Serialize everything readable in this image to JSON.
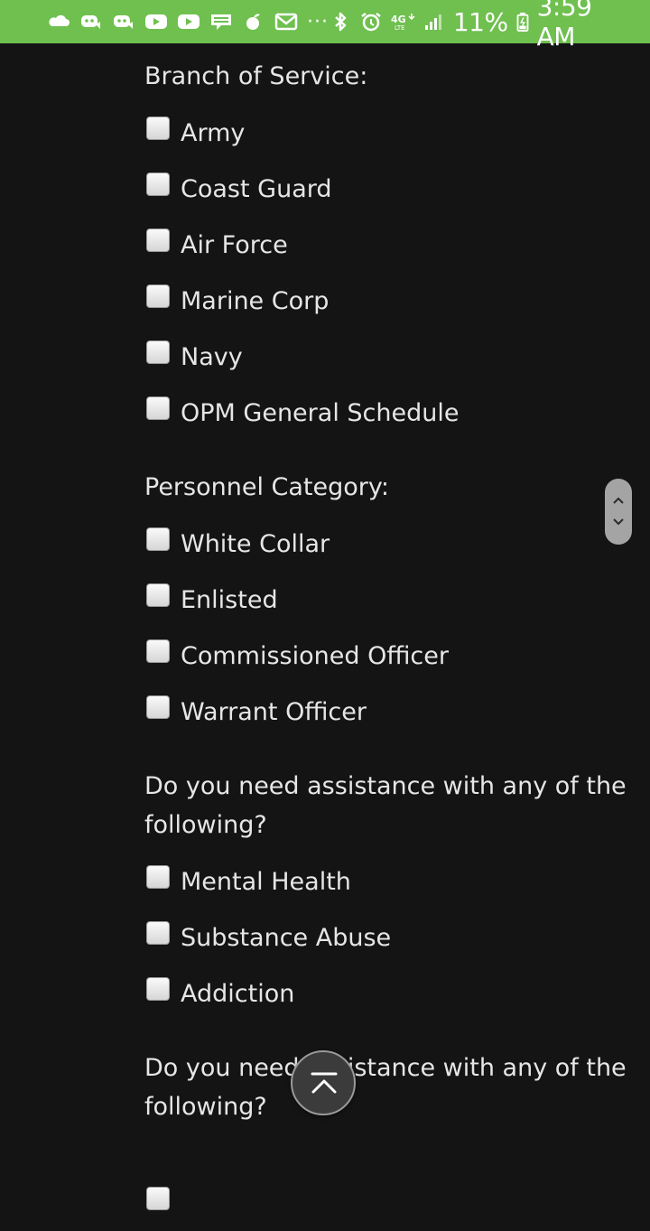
{
  "status_bar": {
    "icons_left": [
      "cloud-icon",
      "discord-icon",
      "discord-icon",
      "youtube-icon",
      "youtube-icon",
      "webtoon-icon",
      "fruit-icon",
      "gmail-icon"
    ],
    "more": "···",
    "icons_right": [
      "bluetooth-icon",
      "alarm-icon",
      "lte-icon",
      "signal-icon"
    ],
    "network": "4G",
    "battery": "11%",
    "time": "3:59 AM"
  },
  "sections": {
    "branch": {
      "heading": "Branch of Service:",
      "options": [
        "Army",
        "Coast Guard",
        "Air Force",
        "Marine Corp",
        "Navy",
        "OPM General Schedule"
      ]
    },
    "personnel": {
      "heading": "Personnel Category:",
      "options": [
        "White Collar",
        "Enlisted",
        "Commissioned Officer",
        "Warrant Officer"
      ]
    },
    "assistance1": {
      "heading": "Do you need assistance with any of the following?",
      "options": [
        "Mental Health",
        "Substance Abuse",
        "Addiction"
      ]
    },
    "assistance2": {
      "heading": "Do you need assistance with any of the following?"
    }
  },
  "colors": {
    "status_bar": "#6fc04f",
    "background": "#141414",
    "text": "#e6e6e6"
  }
}
